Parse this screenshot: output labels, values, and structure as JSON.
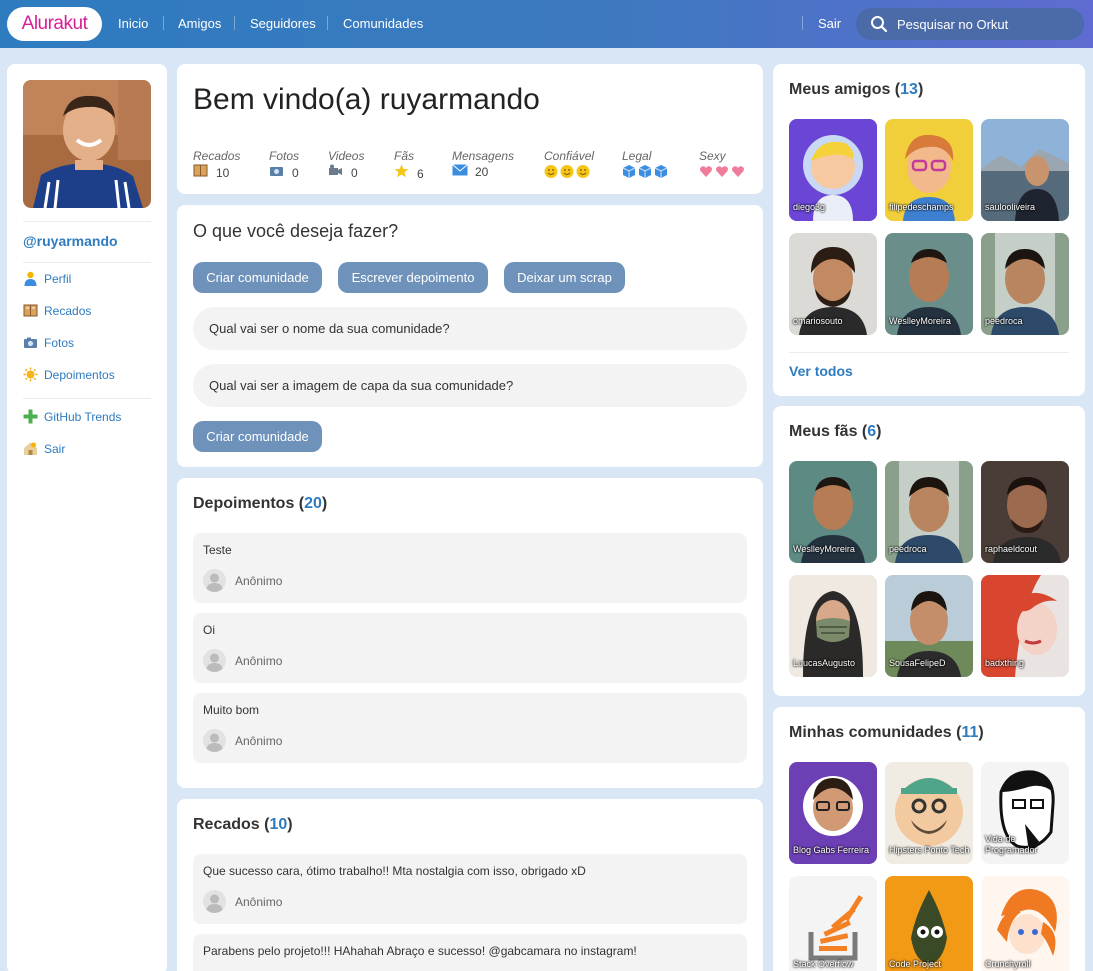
{
  "header": {
    "logo": "Alurakut",
    "nav": [
      "Inicio",
      "Amigos",
      "Seguidores",
      "Comunidades"
    ],
    "logout": "Sair",
    "search_placeholder": "Pesquisar no Orkut"
  },
  "profile": {
    "username": "@ruyarmando",
    "menu": [
      {
        "label": "Perfil",
        "icon": "user-icon"
      },
      {
        "label": "Recados",
        "icon": "book-icon"
      },
      {
        "label": "Fotos",
        "icon": "camera-icon"
      },
      {
        "label": "Depoimentos",
        "icon": "sun-icon"
      },
      {
        "label": "GitHub Trends",
        "icon": "plus-icon"
      },
      {
        "label": "Sair",
        "icon": "logout-icon"
      }
    ]
  },
  "welcome": {
    "title": "Bem vindo(a) ruyarmando",
    "stats": [
      {
        "label": "Recados",
        "value": "10",
        "icon": "book-icon"
      },
      {
        "label": "Fotos",
        "value": "0",
        "icon": "camera-icon"
      },
      {
        "label": "Videos",
        "value": "0",
        "icon": "video-camera-icon"
      },
      {
        "label": "Fãs",
        "value": "6",
        "icon": "star-icon"
      },
      {
        "label": "Mensagens",
        "value": "20",
        "icon": "envelope-icon"
      },
      {
        "label": "Confiável",
        "value": "",
        "icon": "smiley-icon"
      },
      {
        "label": "Legal",
        "value": "",
        "icon": "ice-cube-icon"
      },
      {
        "label": "Sexy",
        "value": "",
        "icon": "heart-icon"
      }
    ],
    "ratings": {
      "Confiável": 3,
      "Legal": 3,
      "Sexy": 3
    }
  },
  "actions": {
    "title": "O que você deseja fazer?",
    "buttons": [
      "Criar comunidade",
      "Escrever depoimento",
      "Deixar um scrap"
    ],
    "fields": [
      "Qual vai ser o nome da sua comunidade?",
      "Qual vai ser a imagem de capa da sua comunidade?"
    ],
    "submit": "Criar comunidade"
  },
  "depoimentos": {
    "title": "Depoimentos",
    "count": "20",
    "items": [
      {
        "text": "Teste",
        "author": "Anônimo"
      },
      {
        "text": "Oi",
        "author": "Anônimo"
      },
      {
        "text": "Muito bom",
        "author": "Anônimo"
      }
    ]
  },
  "recados": {
    "title": "Recados",
    "count": "10",
    "items": [
      {
        "text": "Que sucesso cara, ótimo trabalho!! Mta nostalgia com isso, obrigado xD",
        "author": "Anônimo"
      },
      {
        "text": "Parabens pelo projeto!!! HAhahah Abraço e sucesso! @gabcamara no instagram!",
        "author": ""
      }
    ]
  },
  "friends": {
    "title": "Meus amigos",
    "count": "13",
    "items": [
      "diego3g",
      "filipedeschamps",
      "saulooliveira",
      "omariosouto",
      "WeslleyMoreira",
      "peedroca"
    ],
    "see_all": "Ver todos"
  },
  "fans": {
    "title": "Meus fãs",
    "count": "6",
    "items": [
      "WeslleyMoreira",
      "peedroca",
      "raphaeldcout",
      "LuucasAugusto",
      "SousaFelipeD",
      "badxthing"
    ]
  },
  "communities": {
    "title": "Minhas comunidades",
    "count": "11",
    "items": [
      "Blog Gabs Ferreira",
      "Hipsters Ponto Tech",
      "Vida de Programador",
      "Stack Overflow",
      "Code Project",
      "Crunchyroll"
    ]
  }
}
